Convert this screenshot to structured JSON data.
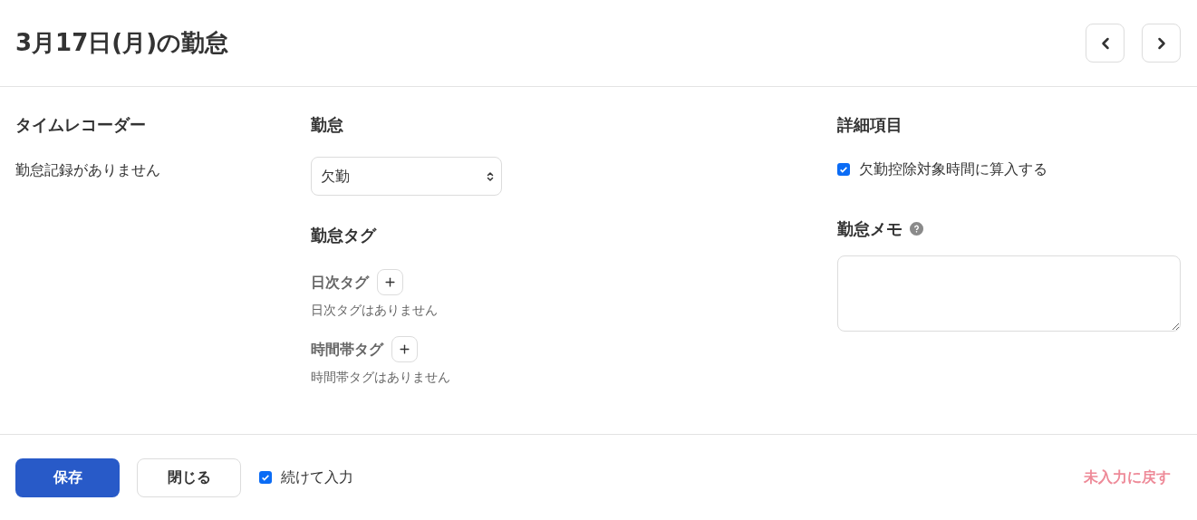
{
  "header": {
    "title": "3月17日(月)の勤怠"
  },
  "time_recorder": {
    "heading": "タイムレコーダー",
    "empty_text": "勤怠記録がありません"
  },
  "attendance": {
    "heading": "勤怠",
    "select": {
      "value": "欠勤"
    },
    "tags_heading": "勤怠タグ",
    "tag_groups": [
      {
        "label": "日次タグ",
        "empty_text": "日次タグはありません"
      },
      {
        "label": "時間帯タグ",
        "empty_text": "時間帯タグはありません"
      }
    ]
  },
  "details": {
    "heading": "詳細項目",
    "checkbox": {
      "label": "欠勤控除対象時間に算入する",
      "checked": true
    },
    "memo_label": "勤怠メモ"
  },
  "footer": {
    "save": "保存",
    "close": "閉じる",
    "continue_checkbox": {
      "label": "続けて入力",
      "checked": true
    },
    "reset_link": {
      "label": "未入力に戻す",
      "disabled": true
    }
  }
}
